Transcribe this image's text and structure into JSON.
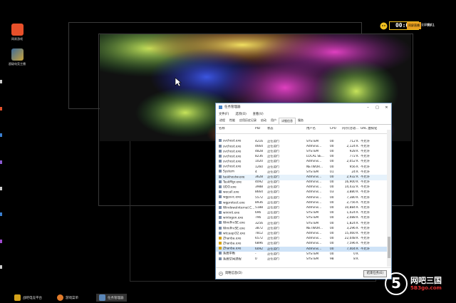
{
  "desktop": {
    "icons": [
      {
        "label": "网易游戏",
        "color": "#e8502a"
      },
      {
        "label": "超级电竞主播",
        "color": "#c9a33a"
      }
    ]
  },
  "hud": {
    "timer": "00:01",
    "mode_label": "全屏模式",
    "live_label": "同屏直播",
    "extra_label": "00:1"
  },
  "task_manager": {
    "title": "任务管理器",
    "menu": [
      "文件(F)",
      "选项(O)",
      "查看(V)"
    ],
    "tabs": [
      "进程",
      "性能",
      "应用历史记录",
      "启动",
      "用户",
      "详细信息",
      "服务"
    ],
    "active_tab": "详细信息",
    "columns": [
      "名称",
      "PID",
      "状态",
      "用户名",
      "CPU",
      "内存(活动...",
      "UAC 虚拟化"
    ],
    "rows": [
      [
        "svchost.exe",
        "4216",
        "正在运行",
        "SYSTEM",
        "00",
        "712 K",
        "不允许"
      ],
      [
        "svchost.exe",
        "4664",
        "正在运行",
        "Adminis...",
        "00",
        "2,124 K",
        "不允许"
      ],
      [
        "svchost.exe",
        "4828",
        "正在运行",
        "SYSTEM",
        "00",
        "928 K",
        "不允许"
      ],
      [
        "svchost.exe",
        "8236",
        "正在运行",
        "LOCAL SE...",
        "00",
        "772 K",
        "不允许"
      ],
      [
        "svchost.exe",
        "1020",
        "正在运行",
        "Adminis...",
        "00",
        "2,052 K",
        "不允许"
      ],
      [
        "svchost.exe",
        "1260",
        "正在运行",
        "NETWOR...",
        "00",
        "956 K",
        "不允许"
      ],
      [
        "System",
        "4",
        "正在运行",
        "SYSTEM",
        "01",
        "24 K",
        "不允许"
      ],
      [
        "taskhostw.exe",
        "3628",
        "正在运行",
        "Adminis...",
        "00",
        "2,932 K",
        "不允许"
      ],
      [
        "TaskMgr.exe",
        "4092",
        "正在运行",
        "Adminis...",
        "00",
        "16,900 K",
        "不允许"
      ],
      [
        "UDO.exe",
        "3988",
        "正在运行",
        "Adminis...",
        "00",
        "14,432 K",
        "不允许"
      ],
      [
        "wecall.exe",
        "8664",
        "正在运行",
        "Adminis...",
        "03",
        "3,880 K",
        "不允许"
      ],
      [
        "wgpsvc.exe",
        "5572",
        "正在运行",
        "Adminis...",
        "00",
        "7,380 K",
        "不允许"
      ],
      [
        "wgprotect.exe",
        "8936",
        "正在运行",
        "Adminis...",
        "00",
        "2,756 K",
        "不允许"
      ],
      [
        "WindowsInternal.C...",
        "5188",
        "正在运行",
        "Adminis...",
        "00",
        "10,884 K",
        "不允许"
      ],
      [
        "wininit.exe",
        "696",
        "正在运行",
        "SYSTEM",
        "00",
        "1,024 K",
        "不允许"
      ],
      [
        "winlogon.exe",
        "796",
        "正在运行",
        "SYSTEM",
        "00",
        "2,088 K",
        "不允许"
      ],
      [
        "WmiPrvSE.exe",
        "3256",
        "正在运行",
        "SYSTEM",
        "00",
        "1,824 K",
        "不允许"
      ],
      [
        "WmiPrvSE.exe",
        "3872",
        "正在运行",
        "NETWOR...",
        "00",
        "3,296 K",
        "不允许"
      ],
      [
        "wtcaapi32.exe",
        "7812",
        "正在运行",
        "Adminis...",
        "00",
        "15,460 K",
        "不允许"
      ],
      [
        "Zhanba.exe",
        "6572",
        "正在运行",
        "Adminis...",
        "00",
        "22,048 K",
        "不允许"
      ],
      [
        "Zhanba.exe",
        "6896",
        "正在运行",
        "Adminis...",
        "00",
        "7,596 K",
        "不允许"
      ],
      [
        "Zhanba.exe",
        "6092",
        "正在运行",
        "Adminis...",
        "00",
        "7,404 K",
        "不允许"
      ],
      [
        "系统中断",
        "-",
        "正在运行",
        "SYSTEM",
        "00",
        "0 K",
        ""
      ],
      [
        "系统空闲进程",
        "0",
        "正在运行",
        "SYSTEM",
        "98",
        "8 K",
        ""
      ]
    ],
    "footer_less": "简略信息(D)",
    "footer_end": "结束任务(E)"
  },
  "taskbar": {
    "items": [
      {
        "label": "战吧电竞平台",
        "color": "#d4a21a"
      },
      {
        "label": "游戏菜单",
        "color": "#e07a2a"
      },
      {
        "label": "任务管理器",
        "color": "#5a86b8"
      }
    ]
  },
  "watermark": {
    "logo": "5",
    "brand": "网吧三国",
    "domain": "5B3go.com"
  }
}
